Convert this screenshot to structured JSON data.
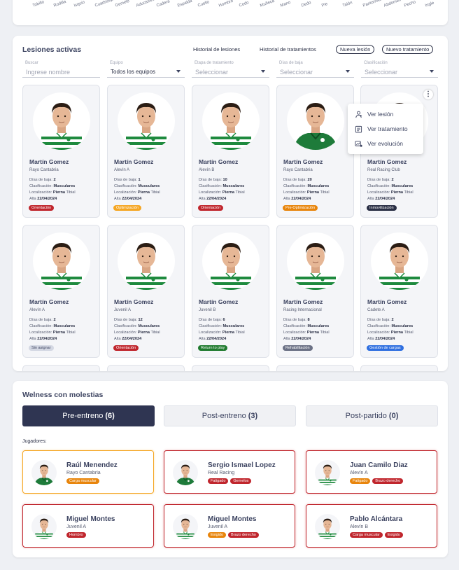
{
  "top_chart": {
    "axis_labels": [
      "Tobillo",
      "Rodilla",
      "Isquio",
      "Cuadriceps",
      "Gemelo",
      "Aductores",
      "Cadera",
      "Espalda",
      "Cuello",
      "Hombro",
      "Codo",
      "Muñeca",
      "Mano",
      "Dedo",
      "Pie",
      "Talón",
      "Pantorrilla",
      "Abdomen",
      "Pecho",
      "Ingle"
    ]
  },
  "lesiones": {
    "title": "Lesiones activas",
    "links": {
      "historial_lesiones": "Historial de lesiones",
      "historial_tratamientos": "Historial de tratamientos"
    },
    "buttons": {
      "nueva_lesion": "Nueva lesión",
      "nuevo_tratamiento": "Nuevo tratamiento"
    },
    "filters": {
      "buscar_label": "Buscar",
      "buscar_placeholder": "Ingrese nombre",
      "equipo_label": "Equipo",
      "equipo_value": "Todos los equipos",
      "etapa_label": "Etapa de tratamiento",
      "etapa_value": "Seleccionar",
      "dias_label": "Días de baja",
      "dias_value": "Seleccionar",
      "clasif_label": "Clasificación",
      "clasif_value": "Seleccionar"
    },
    "line_labels": {
      "dias": "Días de baja: ",
      "clasif": "Clasificación: ",
      "local": "Localización: ",
      "alta": "Alta "
    },
    "players": [
      {
        "name": "Martín Gomez",
        "team": "Rayo Cantabria",
        "dias": "2",
        "clasif": "Musculares",
        "loc_strong": "Pierna",
        "loc_rest": " Tibial",
        "alta": "22/04/2024",
        "tag": "Orientación",
        "tag_color": "#c0262d",
        "kit": "hoops"
      },
      {
        "name": "Martín Gomez",
        "team": "Alevín A",
        "dias": "1",
        "clasif": "Musculares",
        "loc_strong": "Pierna",
        "loc_rest": " Tibial",
        "alta": "22/04/2024",
        "tag": "Optimización",
        "tag_color": "#f5a623",
        "kit": "hoops"
      },
      {
        "name": "Martín Gomez",
        "team": "Alevín B",
        "dias": "10",
        "clasif": "Musculares",
        "loc_strong": "Pierna",
        "loc_rest": " Tibial",
        "alta": "22/04/2024",
        "tag": "Orientación",
        "tag_color": "#c0262d",
        "kit": "hoops"
      },
      {
        "name": "Martín Gomez",
        "team": "Rayo Cantabria",
        "dias": "20",
        "clasif": "Musculares",
        "loc_strong": "Pierna",
        "loc_rest": " Tibial",
        "alta": "22/04/2024",
        "tag": "Pre-Optimización",
        "tag_color": "#e8850c",
        "kit": "green"
      },
      {
        "name": "Martín Gomez",
        "team": "Real Racing Club",
        "dias": "2",
        "clasif": "Musculares",
        "loc_strong": "Pierna",
        "loc_rest": " Tibial",
        "alta": "22/04/2024",
        "tag": "Inmovilización",
        "tag_color": "#2a2f45",
        "kit": "hoops"
      },
      {
        "name": "Martín Gomez",
        "team": "Alevín A",
        "dias": "2",
        "clasif": "Musculares",
        "loc_strong": "Pierna",
        "loc_rest": " Tibial",
        "alta": "22/04/2024",
        "tag": "Sin asignar",
        "tag_color": "#d4d8e3",
        "tag_text": "#3d4461",
        "kit": "hoops"
      },
      {
        "name": "Martín Gomez",
        "team": "Juvenil A",
        "dias": "12",
        "clasif": "Musculares",
        "loc_strong": "Pierna",
        "loc_rest": " Tibial",
        "alta": "22/04/2024",
        "tag": "Orientación",
        "tag_color": "#c0262d",
        "kit": "hoops"
      },
      {
        "name": "Martín Gomez",
        "team": "Juvenil B",
        "dias": "6",
        "clasif": "Musculares",
        "loc_strong": "Pierna",
        "loc_rest": " Tibial",
        "alta": "22/04/2024",
        "tag": "Return to play",
        "tag_color": "#1f7a2e",
        "kit": "hoops"
      },
      {
        "name": "Martín Gomez",
        "team": "Racing Internacional",
        "dias": "8",
        "clasif": "Musculares",
        "loc_strong": "Pierna",
        "loc_rest": " Tibial",
        "alta": "22/04/2024",
        "tag": "Rehabilitación",
        "tag_color": "#6b7185",
        "kit": "hoops"
      },
      {
        "name": "Martín Gomez",
        "team": "Cadete A",
        "dias": "2",
        "clasif": "Musculares",
        "loc_strong": "Pierna",
        "loc_rest": " Tibial",
        "alta": "22/04/2024",
        "tag": "Gestión de cargas",
        "tag_color": "#2f6fe0",
        "kit": "hoops"
      }
    ],
    "menu": [
      {
        "label": "Ver lesión",
        "icon": "user-injury-icon"
      },
      {
        "label": "Ver tratamiento",
        "icon": "clipboard-icon"
      },
      {
        "label": "Ver evolución",
        "icon": "chart-user-icon"
      }
    ]
  },
  "welness": {
    "title": "Welness con molestias",
    "tabs": [
      {
        "label": "Pre-entreno",
        "count": "(6)",
        "active": true
      },
      {
        "label": "Post-entreno",
        "count": "(3)",
        "active": false
      },
      {
        "label": "Post-partido",
        "count": "(0)",
        "active": false
      }
    ],
    "jugadores_label": "Jugadores:",
    "players": [
      {
        "name": "Raúl Menendez",
        "team": "Rayo Cantabria",
        "border": "#f5a623",
        "kit": "green",
        "tags": [
          {
            "text": "Carga muscular",
            "color": "#e8850c"
          }
        ]
      },
      {
        "name": "Sergio Ismael Lopez",
        "team": "Real Racing",
        "border": "#c0262d",
        "kit": "green",
        "tags": [
          {
            "text": "Fatigado",
            "color": "#c0262d"
          },
          {
            "text": "Gemelos",
            "color": "#c0262d"
          }
        ]
      },
      {
        "name": "Juan Camilo Diaz",
        "team": "Alevín A",
        "border": "#c0262d",
        "kit": "hoops",
        "tags": [
          {
            "text": "Fatigado",
            "color": "#e8850c"
          },
          {
            "text": "Brazo derecho",
            "color": "#c0262d"
          }
        ]
      },
      {
        "name": "Miguel Montes",
        "team": "Juvenil A",
        "border": "#c0262d",
        "kit": "hoops",
        "tags": [
          {
            "text": "Hombro",
            "color": "#c0262d"
          }
        ]
      },
      {
        "name": "Miguel Montes",
        "team": "Juvenil A",
        "border": "#c0262d",
        "kit": "hoops",
        "tags": [
          {
            "text": "Exigido",
            "color": "#e8850c"
          },
          {
            "text": "Brazo derecho",
            "color": "#c0262d"
          }
        ]
      },
      {
        "name": "Pablo Alcántara",
        "team": "Alevín B",
        "border": "#c0262d",
        "kit": "hoops",
        "tags": [
          {
            "text": "Carga muscular",
            "color": "#c0262d"
          },
          {
            "text": "Exigido",
            "color": "#c0262d"
          }
        ]
      }
    ]
  }
}
